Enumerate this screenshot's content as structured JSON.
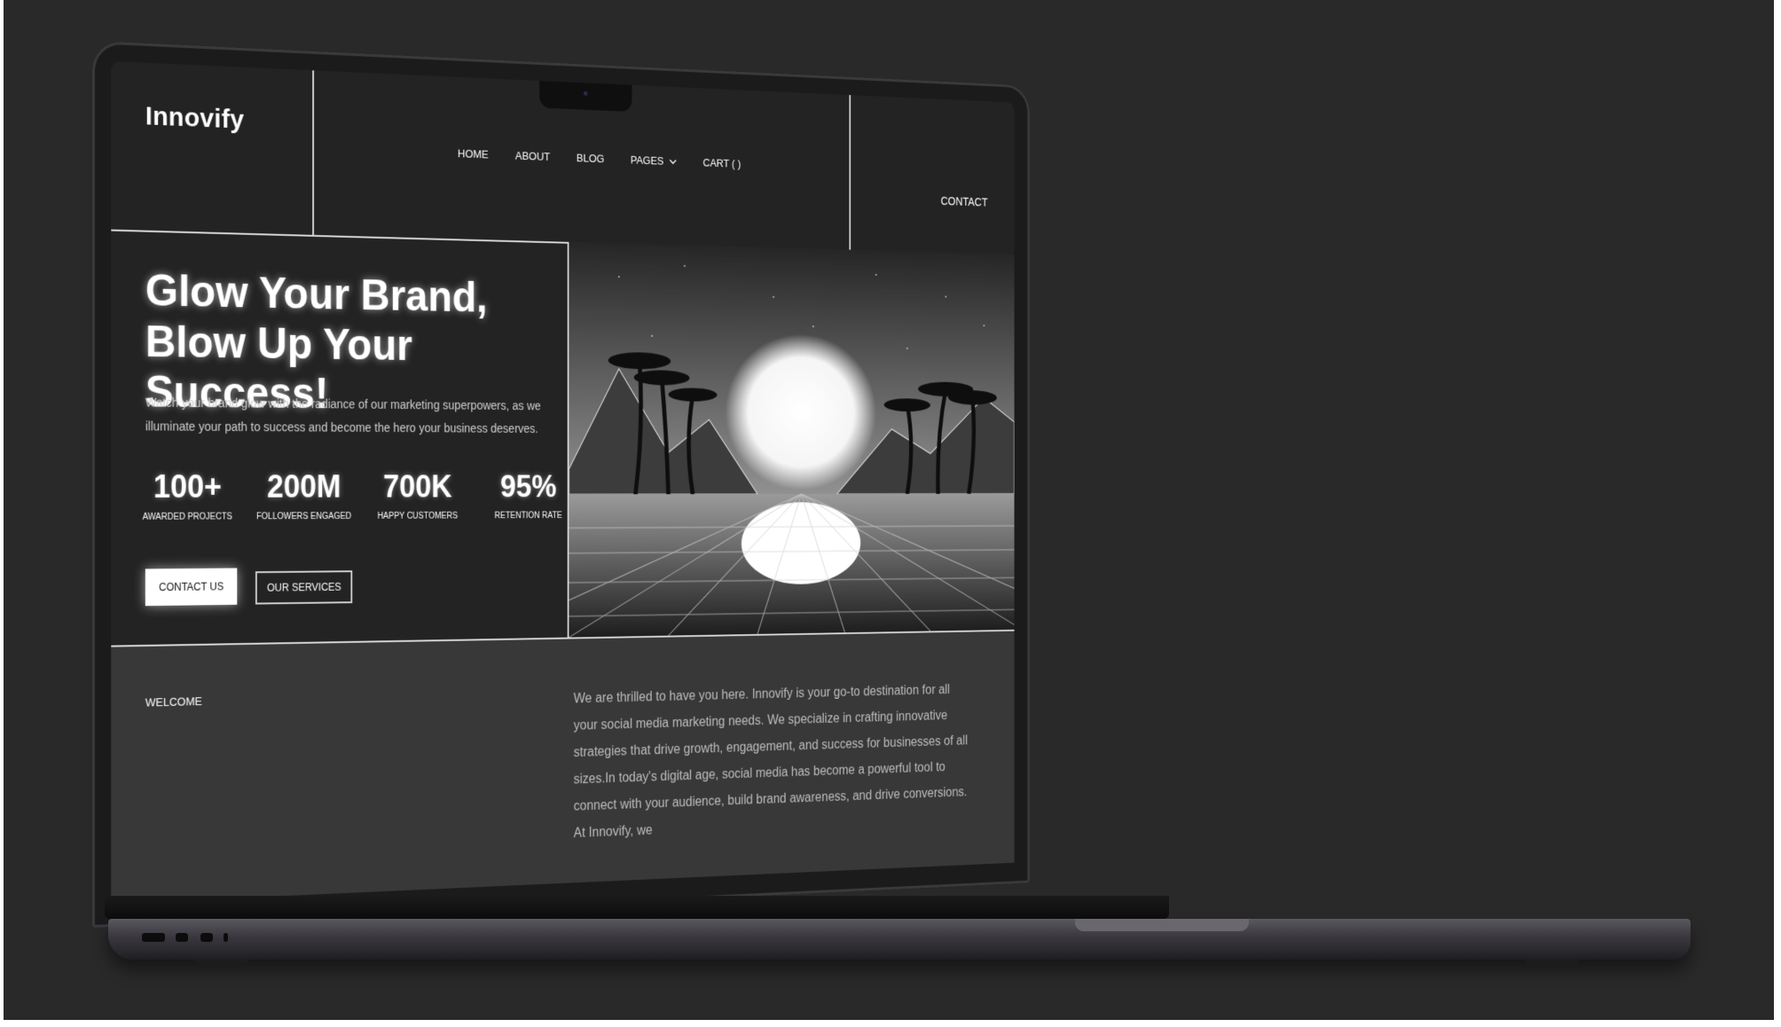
{
  "nav": {
    "logo": "Innovify",
    "links": [
      "HOME",
      "ABOUT",
      "BLOG",
      "PAGES",
      "CART (  )"
    ],
    "contact": "CONTACT"
  },
  "hero": {
    "headline": "Glow Your Brand, Blow Up Your Success!",
    "subtext": "Watch your brand glow with the radiance of our marketing superpowers, as we illuminate your path to success and become the hero your business deserves.",
    "stats": [
      {
        "value": "100+",
        "label": "AWARDED PROJECTS"
      },
      {
        "value": "200M",
        "label": "FOLLOWERS ENGAGED"
      },
      {
        "value": "700K",
        "label": "HAPPY CUSTOMERS"
      },
      {
        "value": "95%",
        "label": "RETENTION RATE"
      }
    ],
    "primary_button": "CONTACT US",
    "secondary_button": "OUR SERVICES"
  },
  "welcome": {
    "label": "WELCOME",
    "text": "We are thrilled to have you here. Innovify is your go-to destination for all your social media marketing needs. We specialize in crafting innovative strategies that drive growth, engagement, and success for businesses of all sizes.In today's digital age, social media has become a powerful tool to connect with your audience, build brand awareness, and drive conversions. At Innovify, we"
  },
  "icons": {
    "pages_dropdown": "chevron-down-icon",
    "camera": "camera-icon"
  }
}
